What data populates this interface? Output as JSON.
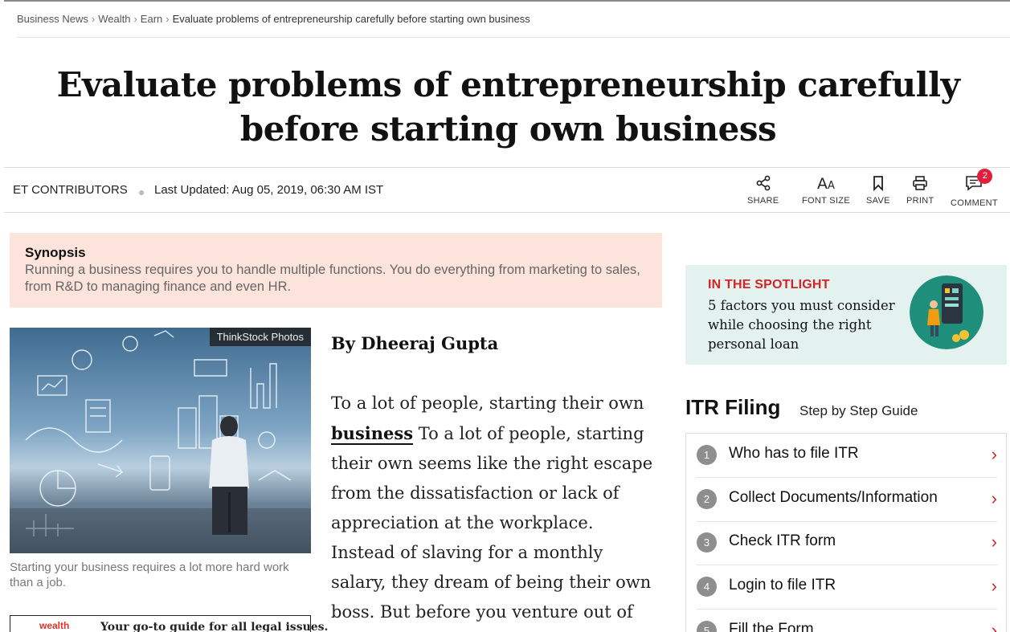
{
  "breadcrumb": {
    "items": [
      "Business News",
      "Wealth",
      "Earn"
    ],
    "current": "Evaluate problems of entrepreneurship carefully before starting own business",
    "separator": "›"
  },
  "article": {
    "headline_line1": "Evaluate problems of entrepreneurship carefully",
    "headline_line2": "before starting own business",
    "author": "ET CONTRIBUTORS",
    "updated": "Last Updated: Aug 05, 2019, 06:30 AM IST",
    "byline": "By Dheeraj Gupta",
    "body": {
      "lead": "To a lot of people, starting their own",
      "link": "business",
      "rest": " To a lot of people, starting their own seems like the right escape from the dissatisfaction or lack of appreciation at the workplace. Instead of slaving for a monthly salary, they dream of being their own boss. But  before you venture out of the comfort"
    }
  },
  "actions": {
    "share": "SHARE",
    "font_size": "FONT SIZE",
    "save": "SAVE",
    "print": "PRINT",
    "comment": "COMMENT",
    "comment_count": "2"
  },
  "synopsis": {
    "title": "Synopsis",
    "text": "Running a business requires you to handle multiple functions. You do everything from marketing to sales, from R&D to managing finance and even HR."
  },
  "image": {
    "credit": "ThinkStock Photos",
    "caption": "Starting your business requires a lot more hard work than a job."
  },
  "promo": {
    "logo": "wealth",
    "text": "Your go-to guide for all legal issues."
  },
  "spotlight": {
    "heading": "IN THE SPOTLIGHT",
    "text": "5 factors you must consider while choosing the right personal loan"
  },
  "itr": {
    "title": "ITR Filing",
    "subtitle": "Step by Step Guide",
    "steps": [
      {
        "num": "1",
        "label": "Who has to file ITR"
      },
      {
        "num": "2",
        "label": "Collect Documents/Information"
      },
      {
        "num": "3",
        "label": "Check ITR form"
      },
      {
        "num": "4",
        "label": "Login to file ITR"
      },
      {
        "num": "5",
        "label": "Fill the Form"
      }
    ]
  },
  "colors": {
    "accent_red": "#d42327",
    "synopsis_bg": "#fce4dc",
    "spotlight_bg": "#e4f2ef",
    "badge_red": "#e11f3a"
  }
}
